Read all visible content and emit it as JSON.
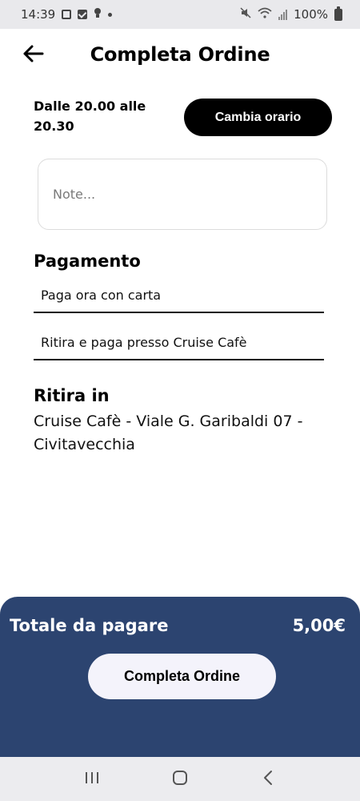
{
  "status_bar": {
    "time": "14:39",
    "battery": "100%",
    "icons": [
      "gallery-icon",
      "checkbox-icon",
      "bulb-icon",
      "dot-icon",
      "mute-icon",
      "wifi-icon",
      "signal-icon",
      "battery-icon"
    ]
  },
  "header": {
    "title": "Completa Ordine",
    "back_icon": "arrow-left-icon"
  },
  "schedule": {
    "time_text": "Dalle 20.00 alle 20.30",
    "change_label": "Cambia orario"
  },
  "notes": {
    "placeholder": "Note..."
  },
  "payment": {
    "title": "Pagamento",
    "options": [
      {
        "label": "Paga ora con carta"
      },
      {
        "label": "Ritira e paga presso Cruise Cafè"
      }
    ]
  },
  "pickup": {
    "title": "Ritira in",
    "address": "Cruise Cafè - Viale G. Garibaldi 07 - Civitavecchia"
  },
  "footer": {
    "total_label": "Totale da pagare",
    "total_value": "5,00€",
    "complete_label": "Completa Ordine"
  },
  "nav_bar": {
    "icons": [
      "recent-apps-icon",
      "home-icon",
      "back-icon"
    ]
  },
  "colors": {
    "footer_bg": "#2c4470",
    "primary_button": "#000000",
    "complete_button_bg": "#f4f3fb"
  }
}
